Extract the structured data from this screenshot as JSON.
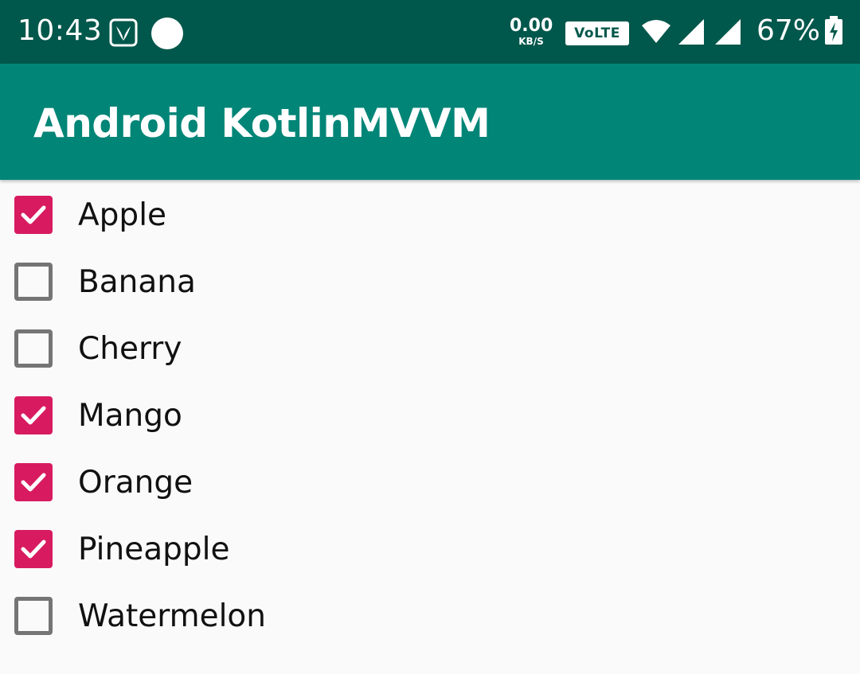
{
  "status_bar": {
    "time": "10:43",
    "net_speed_value": "0.00",
    "net_speed_unit": "KB/S",
    "volte_label": "VoLTE",
    "battery_percent": "67%"
  },
  "app_bar": {
    "title": "Android KotlinMVVM"
  },
  "colors": {
    "status_bar": "#00574b",
    "app_bar": "#008577",
    "checkbox_checked": "#d81b60",
    "checkbox_unchecked": "#757575"
  },
  "items": [
    {
      "label": "Apple",
      "checked": true
    },
    {
      "label": "Banana",
      "checked": false
    },
    {
      "label": "Cherry",
      "checked": false
    },
    {
      "label": "Mango",
      "checked": true
    },
    {
      "label": "Orange",
      "checked": true
    },
    {
      "label": "Pineapple",
      "checked": true
    },
    {
      "label": "Watermelon",
      "checked": false
    }
  ]
}
